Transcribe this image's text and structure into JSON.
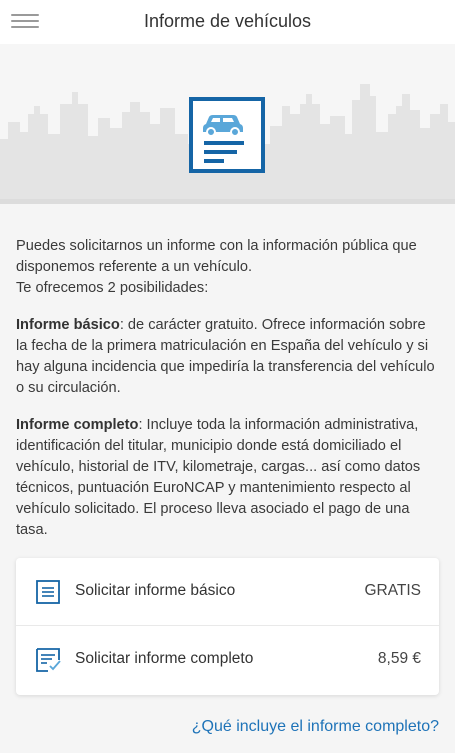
{
  "header": {
    "title": "Informe de vehículos",
    "menu_icon": "hamburger-menu-icon"
  },
  "hero": {
    "icon": "vehicle-report-icon",
    "accent_color": "#1565a6",
    "car_color": "#5aa7d9"
  },
  "intro": {
    "line1": "Puedes solicitarnos un informe con la información pública que disponemos referente a un vehículo.",
    "line2": "Te ofrecemos 2 posibilidades:"
  },
  "basic": {
    "label": "Informe básico",
    "text": ": de carácter gratuito. Ofrece información sobre la fecha de la primera matriculación en España del vehículo y si hay alguna incidencia que impediría la transferencia del vehículo o su circulación."
  },
  "complete": {
    "label": "Informe completo",
    "text": ": Incluye toda la información administrativa, identificación del titular, municipio donde está domiciliado el vehículo, historial de ITV, kilometraje, cargas... así como datos técnicos, puntuación EuroNCAP y mantenimiento respecto al vehículo solicitado. El proceso lleva asociado el pago de una tasa."
  },
  "options": [
    {
      "label": "Solicitar informe básico",
      "price": "GRATIS",
      "icon": "document-list-icon"
    },
    {
      "label": "Solicitar informe completo",
      "price": "8,59 €",
      "icon": "document-check-icon"
    }
  ],
  "link": {
    "label": "¿Qué incluye el informe completo?",
    "color": "#1e73b8"
  }
}
